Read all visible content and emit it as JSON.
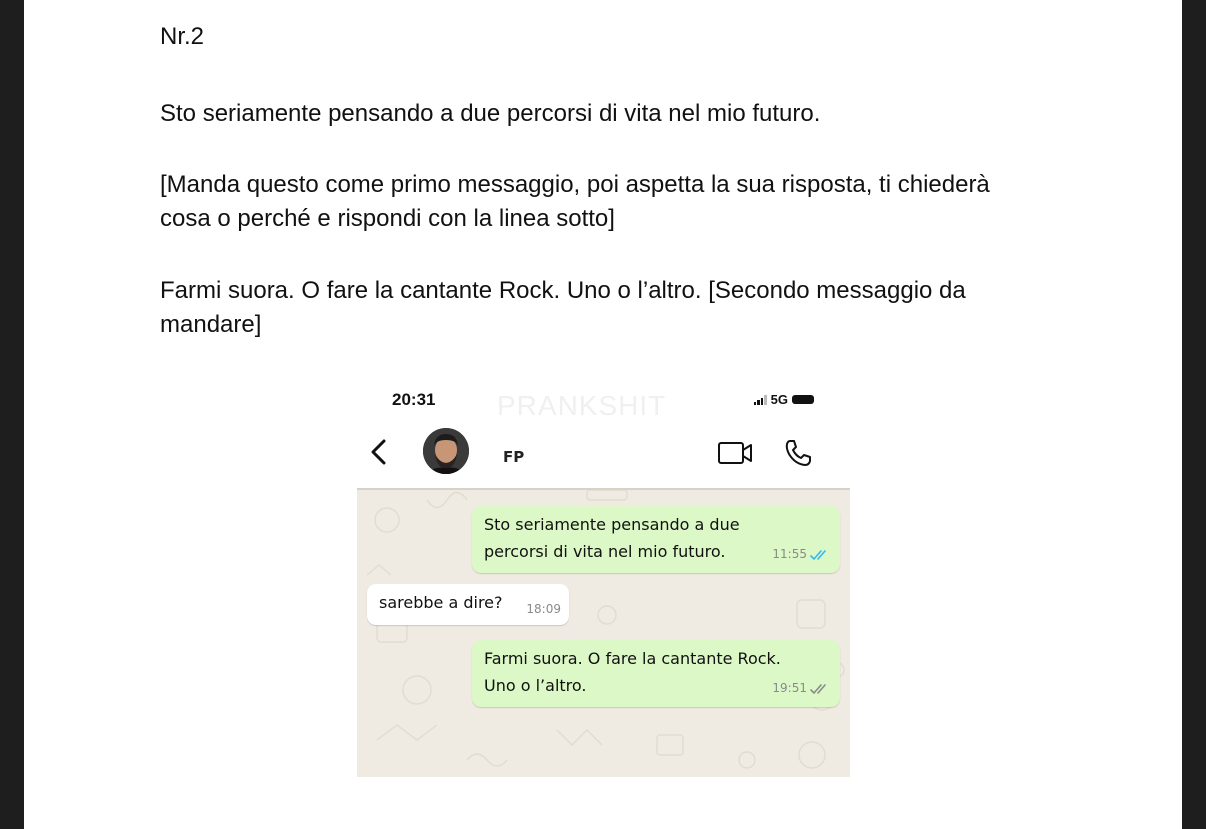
{
  "document": {
    "heading": "Nr.2",
    "paragraph1": "Sto seriamente pensando a due percorsi di vita nel mio futuro.",
    "paragraph2": "[Manda questo come primo messaggio, poi aspetta la sua risposta, ti chiederà cosa o perché e rispondi con la linea sotto]",
    "paragraph3": "Farmi suora. O fare la cantante Rock. Uno o l’altro. [Secondo messaggio da mandare]"
  },
  "screenshot": {
    "status_time": "20:31",
    "network": "5G",
    "watermark": "PRANKSHIT",
    "contact_name": "FP",
    "icons": [
      "back-chevron-icon",
      "avatar",
      "video-call-icon",
      "phone-call-icon",
      "double-check-icon"
    ],
    "colors": {
      "outgoing_bubble": "#dcf8c6",
      "incoming_bubble": "#ffffff",
      "chat_bg": "#efeae2",
      "read_tick": "#34b7f1",
      "sent_tick": "#8a8a8a"
    },
    "messages": [
      {
        "direction": "out",
        "text": "Sto seriamente pensando a due\npercorsi di vita nel mio futuro.",
        "time": "11:55",
        "status": "read"
      },
      {
        "direction": "in",
        "text": "sarebbe a dire?",
        "time": "18:09"
      },
      {
        "direction": "out",
        "text": "Farmi suora. O fare la cantante Rock.\nUno o l’altro.",
        "time": "19:51",
        "status": "delivered"
      }
    ]
  }
}
